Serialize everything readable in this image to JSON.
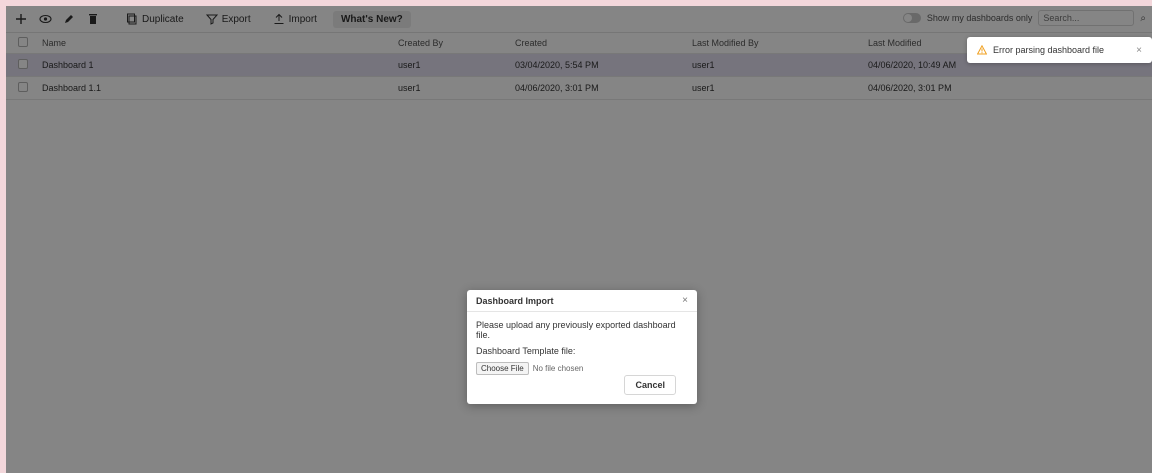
{
  "toolbar": {
    "icons": [
      "plus-icon",
      "eye-icon",
      "pencil-icon",
      "trash-icon"
    ],
    "duplicate_label": "Duplicate",
    "export_label": "Export",
    "import_label": "Import",
    "whats_new_label": "What's New?",
    "show_my_dashboards_label": "Show my dashboards only",
    "search_placeholder": "Search..."
  },
  "table": {
    "columns": [
      "Name",
      "Created By",
      "Created",
      "Last Modified By",
      "Last Modified"
    ],
    "rows": [
      {
        "name": "Dashboard 1",
        "created_by": "user1",
        "created": "03/04/2020, 5:54 PM",
        "modified_by": "user1",
        "modified": "04/06/2020, 10:49 AM",
        "selected": true
      },
      {
        "name": "Dashboard 1.1",
        "created_by": "user1",
        "created": "04/06/2020, 3:01 PM",
        "modified_by": "user1",
        "modified": "04/06/2020, 3:01 PM",
        "selected": false
      }
    ]
  },
  "toast": {
    "message": "Error parsing dashboard file",
    "close": "×"
  },
  "modal": {
    "title": "Dashboard Import",
    "close": "×",
    "description": "Please upload any previously exported dashboard file.",
    "field_label": "Dashboard Template file:",
    "choose_file_label": "Choose File",
    "no_file_label": "No file chosen",
    "cancel_label": "Cancel"
  },
  "colors": {
    "page_background": "#f3d7db",
    "selected_row": "#e2dff0",
    "warning": "#f0a020"
  }
}
